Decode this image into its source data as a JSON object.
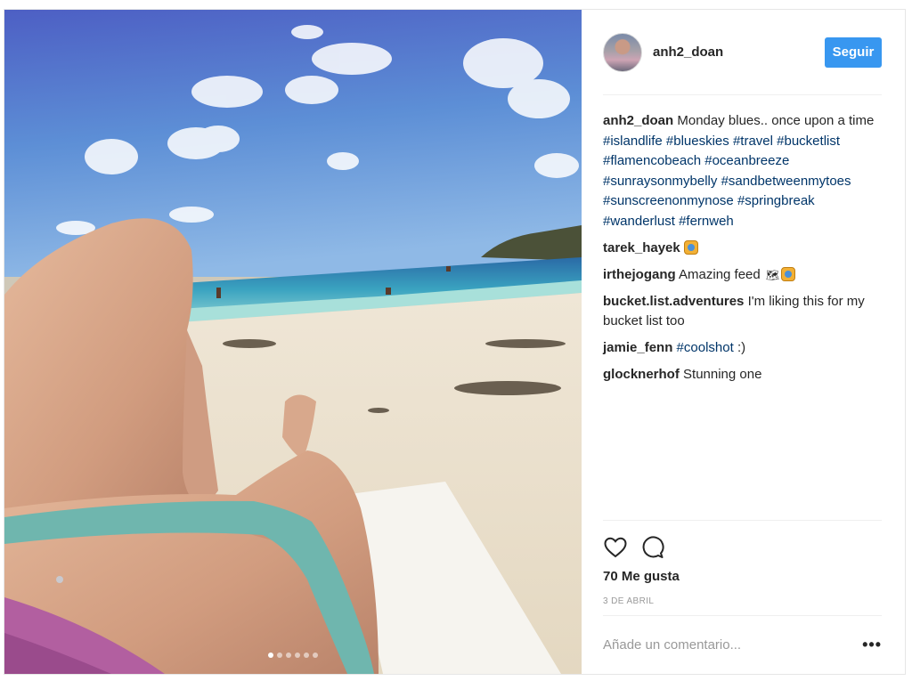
{
  "post": {
    "author": "anh2_doan",
    "follow_label": "Seguir",
    "carousel": {
      "count": 6,
      "active_index": 0
    },
    "comments": [
      {
        "user": "anh2_doan",
        "text": "Monday blues.. once upon a time",
        "tags": [
          "#islandlife",
          "#blueskies",
          "#travel",
          "#bucketlist",
          "#flamencobeach",
          "#oceanbreeze",
          "#sunraysonmybelly",
          "#sandbetweenmytoes",
          "#sunscreenonmynose",
          "#springbreak",
          "#wanderlust",
          "#fernweh"
        ]
      },
      {
        "user": "tarek_hayek",
        "text": "",
        "emoji": "raising-hands-emoji"
      },
      {
        "user": "irthejogang",
        "text": "Amazing feed",
        "emoji": "world-map-raising-hands-emoji"
      },
      {
        "user": "bucket.list.adventures",
        "text": "I'm liking this for my bucket list too"
      },
      {
        "user": "jamie_fenn",
        "text_tag": "#coolshot",
        "text_after": ":)"
      },
      {
        "user": "glocknerhof",
        "text": "Stunning one"
      }
    ],
    "likes_label": "70 Me gusta",
    "date": "3 DE ABRIL",
    "comment_placeholder": "Añade un comentario...",
    "more_label": "•••",
    "icons": {
      "like": "heart-icon",
      "comment": "comment-bubble-icon",
      "more": "more-options-icon"
    }
  }
}
